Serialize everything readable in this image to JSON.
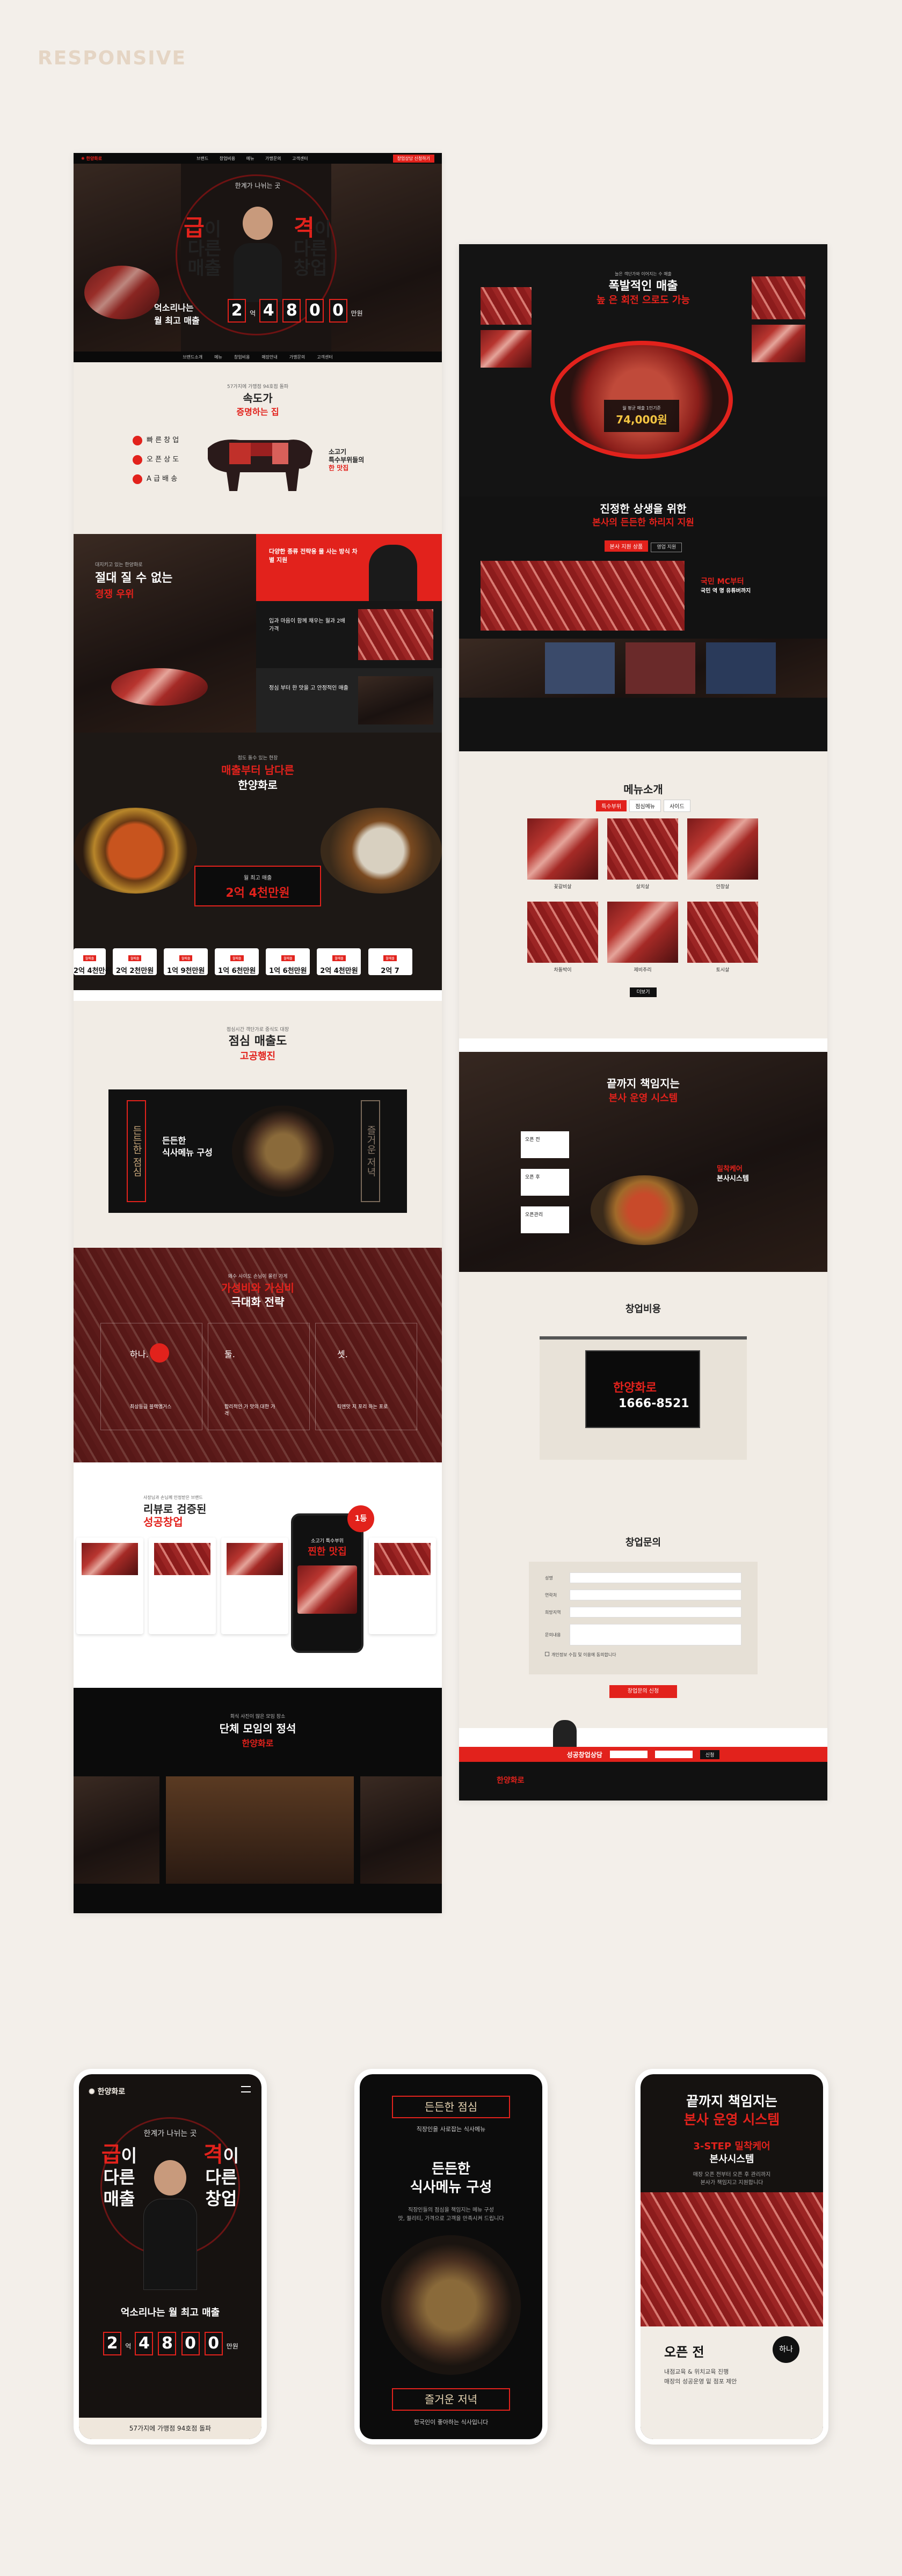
{
  "page": {
    "tag": "RESPONSIVE"
  },
  "colors": {
    "accent": "#e2221c",
    "dark": "#141414",
    "cream": "#f1ece5"
  },
  "desktop_left": {
    "header": {
      "nav": [
        "브랜드",
        "창업비용",
        "메뉴",
        "가맹문의",
        "고객센터"
      ],
      "cta": "창업상담 신청하기"
    },
    "hero": {
      "kicker": "한계가 나뉘는 곳",
      "line1_red": "급",
      "line1": "이",
      "line2": "다른",
      "line3": "매출",
      "line1b_red": "격",
      "line1b": "이",
      "line2b": "다른",
      "line3b": "창업",
      "sub1": "억소리나는",
      "sub2": "월 최고 매출",
      "digits": [
        "2",
        "4",
        "8",
        "0",
        "0"
      ],
      "unit_a": "억",
      "unit": "만원"
    },
    "tabs": [
      "브랜드소개",
      "메뉴",
      "창업비용",
      "매장안내",
      "가맹문의",
      "고객센터"
    ],
    "speed": {
      "kicker": "57가지에 가맹점 94호점 돌파",
      "title1": "속도가",
      "title2": "증명하는 집",
      "items": [
        "빠 른 창 업",
        "오 픈 상 도",
        "A 급 배 송"
      ],
      "meat_label1": "소고기",
      "meat_label2": "특수부위들의",
      "meat_label3": "한 맛집"
    },
    "miss": {
      "kicker": "대지키고 있는 한양화로",
      "title": "절대 질 수 없는",
      "title_red": "경쟁 우위",
      "box1": "다양한 종류 전략용 물 사는 방식 차별 지원",
      "box2": "입과 마음이 함께 채우는 월과 2배 가격",
      "box3": "정심 부터 한 맛을 고 안정적인 매출"
    },
    "tang": {
      "kicker": "점도 돌수 있는 현장",
      "title_red": "매출부터 남다른",
      "title": "한양화로",
      "badge_top": "월 최고 매출",
      "badge": "2억 4천만원",
      "stats": [
        "2억 4천만원",
        "2억 2천만원",
        "1억 9천만원",
        "1억 6천만원",
        "1억 6천만원",
        "2억 4천만원",
        "2억 7"
      ]
    },
    "lunch": {
      "kicker": "점심시간 객단가로 중식도 대장",
      "title1": "점심 매출도",
      "title2": "고공행진",
      "panel_left": "든든한 점심",
      "panel_mid1": "든든한",
      "panel_mid2": "식사메뉴 구성",
      "panel_right": "즐거운 저녁"
    },
    "strategy": {
      "kicker": "왜수 사이도 손님이 몰린 가게",
      "title_red": "가성비와 가심비",
      "title": "극대화 전략",
      "badges": [
        "하나.",
        "둘.",
        "셋."
      ],
      "items": [
        "최상등급 블랙앵거스",
        "합리적인 가 맛의 대한 가격",
        "티엔맛 지 포리 하는 포로"
      ]
    },
    "review": {
      "kicker": "사장님과 손님께 인정받은 브랜드",
      "title1": "리뷰로 검증된",
      "title2": "성공창업",
      "badge": "1등",
      "phone_title": "소고기 특수부위",
      "phone_sub": "찐한 맛집"
    },
    "group": {
      "kicker": "회식 사진이 많은 모임 장소",
      "title": "단체 모임의 정석",
      "brand": "한양화로"
    }
  },
  "desktop_right": {
    "sales": {
      "kicker": "늘은 객단가와 이어지는 수 매출",
      "title1": "폭발적인 매출",
      "title2": "높 은 회전 으로도 가능",
      "badge_top": "월 평균 매출 1인기준",
      "badge": "74,000원"
    },
    "coop": {
      "title1": "진정한 상생을 위한",
      "title2": "본사의 든든한 하리지 지원",
      "btn1": "본사 지원 상품",
      "btn2": "영업 지원",
      "mc1": "국민 MC부터",
      "mc2": "국민 역 명 유튜버까지"
    },
    "menu": {
      "title": "메뉴소개",
      "tabs": [
        "특수부위",
        "점심메뉴",
        "사이드"
      ],
      "items": [
        "꽃갈비살",
        "살치살",
        "안창살",
        "차돌박이",
        "제비추리",
        "토시살"
      ],
      "more": "더보기"
    },
    "care": {
      "title1": "끝까지 책임지는",
      "title2": "본사 운영 시스템",
      "steps": [
        "오픈 전",
        "오픈 후",
        "오픈관리"
      ],
      "side1": "밀착케어",
      "side2": "본사시스템"
    },
    "cost": {
      "title": "창업비용",
      "phone": "1666-8521",
      "brand": "한양화로"
    },
    "inquiry": {
      "title": "창업문의",
      "fields": [
        "성명",
        "연락처",
        "희망지역",
        "문의내용"
      ],
      "agree": "개인정보 수집 및 이용에 동의합니다",
      "submit": "창업문의 신청"
    },
    "footer_banner": {
      "title": "성공창업상담",
      "btn": "신청"
    },
    "footer": {
      "brand": "한양화로"
    }
  },
  "mobiles": {
    "m1": {
      "brand": "한양화로",
      "kicker": "한계가 나뉘는 곳",
      "line1_red": "급",
      "line1": "이",
      "line1b_red": "격",
      "line1b": "이",
      "line2": "다른",
      "line3": "매출",
      "line2b": "다른",
      "line3b": "창업",
      "sub": "억소리나는 월 최고 매출",
      "digits": [
        "2",
        "4",
        "8",
        "0",
        "0"
      ],
      "unit_a": "억",
      "unit": "만원",
      "footer": "57가지에 가맹점 94호점 돌파"
    },
    "m2": {
      "head": "든든한 점심",
      "sub": "직장인을 사로잡는 식사메뉴",
      "title1": "든든한",
      "title2": "식사메뉴 구성",
      "desc1": "직장인들의 점심을 책임지는 메뉴 구성",
      "desc2": "맛, 퀄리티, 가격으로 고객을 만족시켜 드립니다",
      "foot": "즐거운 저녁",
      "foot_sub": "한국인이 좋아하는 식사입니다"
    },
    "m3": {
      "title1": "끝까지 책임지는",
      "title2": "본사 운영 시스템",
      "sub1": "3-STEP 밀착케어",
      "sub2": "본사시스템",
      "desc1": "매장 오픈 전부터 오픈 후 관리까지",
      "desc2": "본사가 책임지고 지원합니다",
      "step": "오픈 전",
      "step_desc1": "내점교육 & 위치교육 진행",
      "step_desc2": "매장의 성공운영 밑 점포 제안",
      "badge": "하나"
    }
  }
}
